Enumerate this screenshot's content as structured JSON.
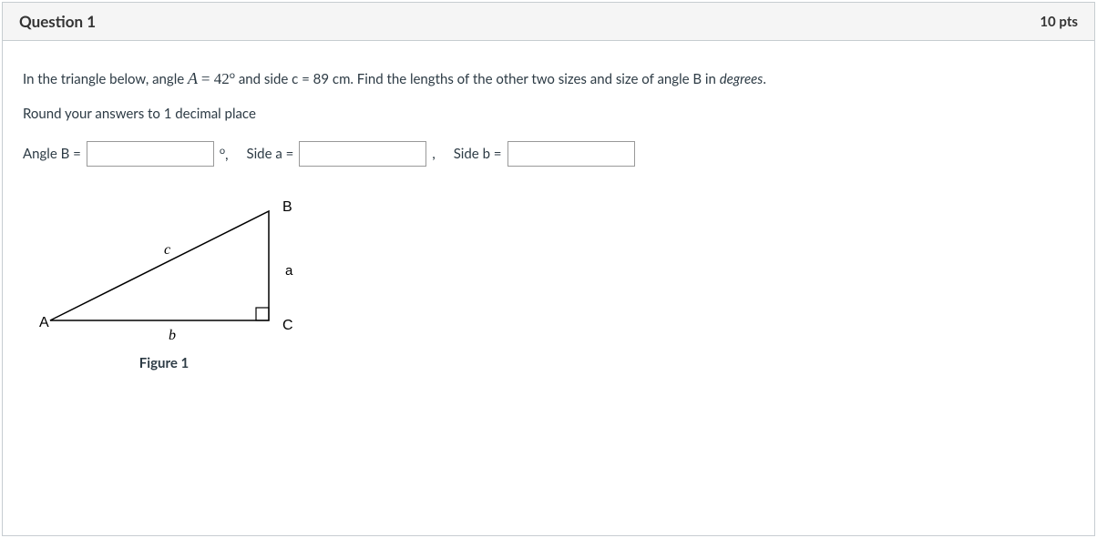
{
  "header": {
    "title": "Question 1",
    "points": "10 pts"
  },
  "prompt": {
    "intro": "In the triangle below, angle ",
    "varA": "A",
    "eq": " = ",
    "angleVal": "42",
    "afterAngle": "and side c = 89 cm.  Find the lengths of the other two sizes and size of angle B in ",
    "degreesWord": "degrees",
    "period": ".",
    "roundLine": "Round your answers to 1 decimal place"
  },
  "answers": {
    "angleB_label": "Angle B =",
    "degComma": ",",
    "sideA_label": "Side a =",
    "comma2": ",",
    "sideB_label": "Side b ="
  },
  "figure": {
    "labelA": "A",
    "labelB": "B",
    "labelC": "C",
    "side_a": "a",
    "side_b": "b",
    "side_c": "c",
    "caption": "Figure 1"
  }
}
